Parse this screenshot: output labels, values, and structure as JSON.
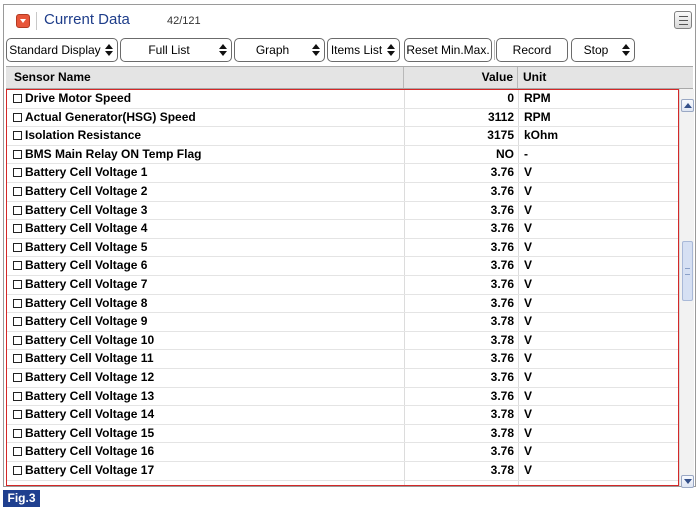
{
  "titlebar": {
    "title": "Current Data",
    "count": "42/121"
  },
  "toolbar": {
    "standard_display": "Standard Display",
    "full_list": "Full List",
    "graph": "Graph",
    "items_list": "Items List",
    "reset_min_max": "Reset Min.Max.",
    "record": "Record",
    "stop": "Stop"
  },
  "table": {
    "headers": {
      "name": "Sensor Name",
      "value": "Value",
      "unit": "Unit"
    },
    "rows": [
      {
        "name": "Drive Motor Speed",
        "value": "0",
        "unit": "RPM"
      },
      {
        "name": "Actual Generator(HSG) Speed",
        "value": "3112",
        "unit": "RPM"
      },
      {
        "name": "Isolation Resistance",
        "value": "3175",
        "unit": "kOhm"
      },
      {
        "name": "BMS Main Relay ON Temp Flag",
        "value": "NO",
        "unit": "-"
      },
      {
        "name": "Battery Cell Voltage 1",
        "value": "3.76",
        "unit": "V"
      },
      {
        "name": "Battery Cell Voltage 2",
        "value": "3.76",
        "unit": "V"
      },
      {
        "name": "Battery Cell Voltage 3",
        "value": "3.76",
        "unit": "V"
      },
      {
        "name": "Battery Cell Voltage 4",
        "value": "3.76",
        "unit": "V"
      },
      {
        "name": "Battery Cell Voltage 5",
        "value": "3.76",
        "unit": "V"
      },
      {
        "name": "Battery Cell Voltage 6",
        "value": "3.76",
        "unit": "V"
      },
      {
        "name": "Battery Cell Voltage 7",
        "value": "3.76",
        "unit": "V"
      },
      {
        "name": "Battery Cell Voltage 8",
        "value": "3.76",
        "unit": "V"
      },
      {
        "name": "Battery Cell Voltage 9",
        "value": "3.78",
        "unit": "V"
      },
      {
        "name": "Battery Cell Voltage 10",
        "value": "3.78",
        "unit": "V"
      },
      {
        "name": "Battery Cell Voltage 11",
        "value": "3.76",
        "unit": "V"
      },
      {
        "name": "Battery Cell Voltage 12",
        "value": "3.76",
        "unit": "V"
      },
      {
        "name": "Battery Cell Voltage 13",
        "value": "3.76",
        "unit": "V"
      },
      {
        "name": "Battery Cell Voltage 14",
        "value": "3.78",
        "unit": "V"
      },
      {
        "name": "Battery Cell Voltage 15",
        "value": "3.78",
        "unit": "V"
      },
      {
        "name": "Battery Cell Voltage 16",
        "value": "3.76",
        "unit": "V"
      },
      {
        "name": "Battery Cell Voltage 17",
        "value": "3.78",
        "unit": "V"
      }
    ]
  },
  "figure_label": "Fig.3",
  "colors": {
    "title": "#1e3d8a",
    "highlight_border": "#d42828",
    "fig_badge": "#1f3f8f",
    "collapse_button": "#e8563a"
  },
  "icons": {
    "collapse": "collapse-arrow-icon",
    "menu": "menu-icon",
    "scroll_up": "scroll-up-arrow-icon",
    "scroll_down": "scroll-down-arrow-icon"
  }
}
